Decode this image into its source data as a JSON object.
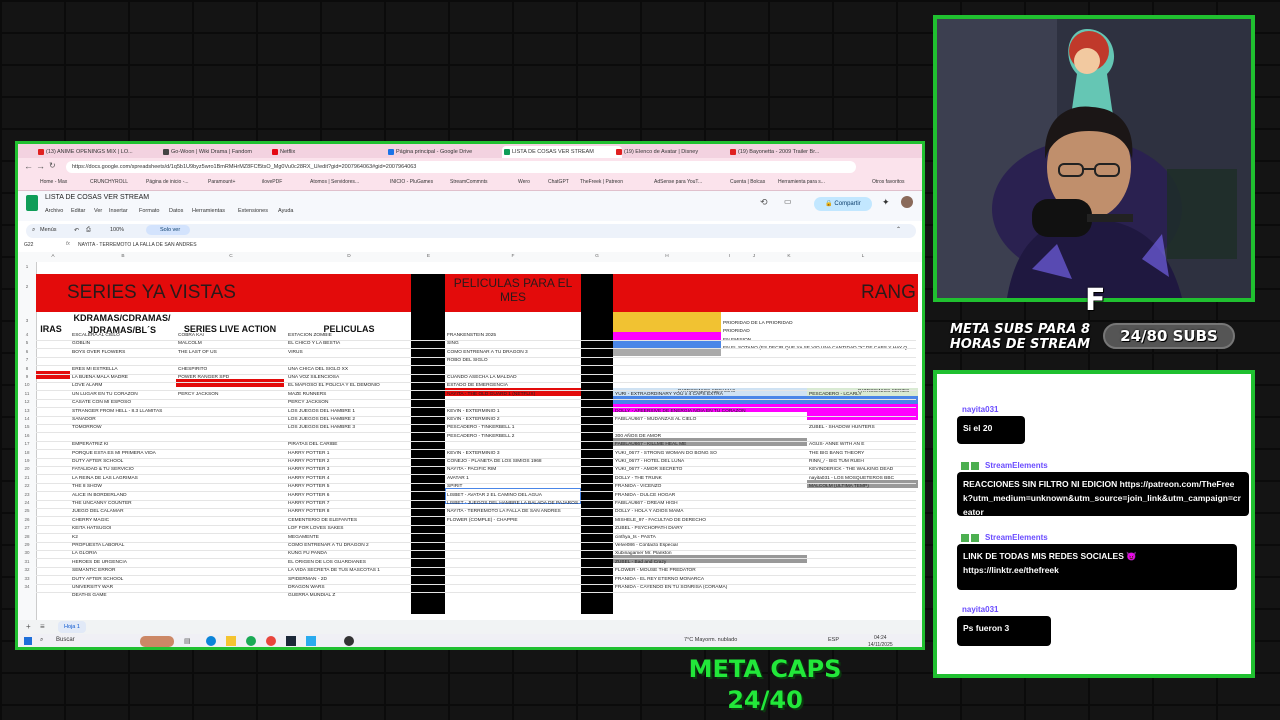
{
  "browser": {
    "tabs": [
      {
        "label": "(13) ANIME OPENINGS MIX | LO...",
        "color": "#e02020"
      },
      {
        "label": "Go-Woon | Wiki Drama | Fandom",
        "color": "#444"
      },
      {
        "label": "Netflix",
        "color": "#e50914"
      },
      {
        "label": "Página principal - Google Drive",
        "color": "#1a73e8"
      },
      {
        "label": "LISTA DE COSAS VER STREAM",
        "color": "#0f9d58"
      },
      {
        "label": "(19) Elenco de Avatar | Disney",
        "color": "#e02020"
      },
      {
        "label": "(19) Bayonetta - 2009 Trailer Br...",
        "color": "#e02020"
      }
    ],
    "url": "https://docs.google.com/spreadsheets/d/1q5b1U9byz5wro1BmRMHrMZ8FCf5tsO_Mg0Vu0c28RX_U/edit?gid=2007964063#gid=2007964063",
    "bookmarks": [
      "Home - Max",
      "CRUNCHYROLL",
      "Página de inicio -...",
      "Paramount+",
      "ilovePDF",
      "Atomos | Servidores...",
      "INICIO - PluGames",
      "StreamCommnts",
      "Wero",
      "ChatGPT",
      "TheFreek | Patreon",
      "AdSense para YouT...",
      "Cuenta | Bolcas",
      "Herramienta para s...",
      "Otros favoritos"
    ]
  },
  "sheet": {
    "title": "LISTA DE COSAS VER STREAM",
    "menus": [
      "Archivo",
      "Editar",
      "Ver",
      "Insertar",
      "Formato",
      "Datos",
      "Herramientas",
      "Extensiones",
      "Ayuda"
    ],
    "share_label": "Compartir",
    "toolbar_menu": "Menús",
    "zoom": "100%",
    "view_mode": "Solo ver",
    "cell_ref": "G22",
    "formula": "NAYITA - TERREMOTO LA FALLA DE SAN ANDRES",
    "columns": [
      "A",
      "B",
      "C",
      "D",
      "E",
      "F",
      "G",
      "H",
      "I",
      "J",
      "K",
      "L"
    ],
    "rows": [
      "1",
      "2",
      "3",
      "4",
      "5",
      "6",
      "7",
      "8",
      "9",
      "10",
      "11",
      "12",
      "13",
      "14",
      "15",
      "16",
      "17",
      "18",
      "19",
      "20",
      "21",
      "22",
      "23",
      "24",
      "25",
      "26",
      "27",
      "28",
      "29",
      "30",
      "31",
      "32",
      "33",
      "34"
    ],
    "series_title": "SERIES YA VISTAS",
    "peliculas_title": "PELICULAS PARA EL MES",
    "rango_title": "RANG",
    "col_partial": "IRAS",
    "col_kdramas": "KDRAMAS/CDRAMAS/ JDRAMAS/BL´S",
    "col_live": "SERIES LIVE ACTION",
    "col_peliculas": "PELICULAS",
    "kdramas": [
      "ESCALERA AL CIELO",
      "GOBLIN",
      "BOYS OVER FLOWERS",
      "",
      "ERES MI ESTRELLA",
      "LA BUENA MALA MADRE",
      "LOVE ALARM",
      "UN LUGAR EN TU CORAZON",
      "CASATE CON MI ESPOSO",
      "STRANGER FROM HELL - 8.3 LLAMITAS",
      "SANADOR",
      "TOMORROW",
      "",
      "EMPERATRIZ KI",
      "PORQUE ESTA ES MI PRIMERA VIDA",
      "DUTY AFTER SCHOOL",
      "FATALIDAD & TU SERVICIO",
      "LA REINA DE LAS LAGRIMAS",
      "THE 8 SHOW",
      "ALICE IN BORDERLAND",
      "THE UNCANNY COUNTER",
      "JUEGO DEL CALAMAR",
      "CHERRY MAGIC",
      "KEITA HATSUGOI",
      "K2",
      "PROPUESTA LABORAL",
      "LA GLORIA",
      "HEROES DE URGENCIA",
      "SEMANTIC ERROR",
      "DUTY AFTER SCHOOL",
      "UNIVERSITY WAR",
      "DEATHS GAME"
    ],
    "live_action": [
      "COBRA KAI",
      "MALCOLM",
      "THE LAST OF US",
      "",
      "CHESPIRITO",
      "POWER RANGER SPD",
      "",
      "PERCY JACKSON"
    ],
    "peliculas": [
      "ESTACION ZOMBIE",
      "EL CHICO Y LA BESTIA",
      "VIRUS",
      "",
      "UNA CHICA DEL SIGLO XX",
      "UNA VOZ SILENCIOSA",
      "EL MAFIOSO EL POLICIA Y EL DEMONIO",
      "MAZE RUNNERS",
      "PERCY JACKSON",
      "LOS JUEGOS DEL HAMBRE 1",
      "LOS JUEGOS DEL HAMBRE 2",
      "LOS JUEGOS DEL HAMBRE 3",
      "",
      "PIRATAS DEL CARIBE",
      "HARRY POTTER 1",
      "HARRY POTTER 2",
      "HARRY POTTER 3",
      "HARRY POTTER 4",
      "HARRY POTTER 5",
      "HARRY POTTER 6",
      "HARRY POTTER 7",
      "HARRY POTTER 8",
      "CEMENTERIO DE ELEFANTES",
      "LOF FOR LOVES SAKES",
      "MEGAMENTE",
      "COMO ENTRENAR A TU DRAGON 2",
      "KUNG FU PANDA",
      "EL ORIGEN DE LOS GUARDIANES",
      "LA VIDA SECRETA DE TUS MASCOTAS 1",
      "SPIDERMAN - 2D",
      "DRAGON WARS",
      "GUERRA MUNDIAL Z"
    ],
    "peliculas_mes": [
      "FRANKENSTEIN 2025",
      "SING",
      "COMO ENTRENAR A TU DRAGON 3",
      "ROBO DEL SIGLO",
      "",
      "CUANDO ASECHA LA MALDAD",
      "ESTADO DE EMERGENCIA",
      "NAYITA - THE OLD GUARD 1 (NETFLIX)",
      "",
      "KEVIN - EXTERMINIO 1",
      "KEVIN - EXTERMINIO 2",
      "PESCADERO - TINKERBELL 1",
      "PESCADERO - TINKERBELL 2",
      "",
      "KEVIN - EXTERMINIO 3",
      "CONEJO - PLANETA DE LOS SIMIOS 1968",
      "NAYITA - PACIFIC RIM",
      "AVATAR 1",
      "SPIRIT",
      "LISBET - AVATAR 2 EL CAMINO DEL AGUA",
      "LISBET - JUEGOS DEL HAMBRE LA BALADA DE PAJAROS",
      "NAYITA - TERREMOTO LA FALLA DE SAN ANDRES",
      "FLOWER (COMPLE) - CHAPPIE"
    ],
    "legend": [
      "PRIORIDAD DE LA PRIORIDAD",
      "PRIORIDAD",
      "EN EMISION",
      "EN EL SOTANO (ES DECIR QUE YA SE VIO UNA CANTIDAD \"X\" DE CAPS Y HAY Q"
    ],
    "patrocinios_kdramas_title": "PATROCINIOS KDRAMAS",
    "patrocinios_series_title": "PATROCINIOS SERIES",
    "patrocinios_kdramas": [
      "YURI - EXTRAORDINARY YOU x 4 CAPS EXTRA",
      "",
      "DOLLY - AFEERSIVE DE ENERGIA NOIA EN TU CORAZON",
      "FABILAU667 - MUDANZAS AL CIELO",
      "",
      "300 AÑOS DE AMOR",
      "FABILAU667 - KILLME HEAL ME",
      "YUKI_0677 - STRONG WOMAN DO BONG SO",
      "YUKI_0677 - HOTEL DEL LUNA",
      "YUKI_0677 - AMOR SECRETO",
      "DOLLY - THE TRUNK",
      "FRANIDA - VICENZO",
      "FRANIDA - DULCE HOGAR",
      "FABILAU667 - DREAM HIGH",
      "DOLLY - HOLA Y ADIOS MAMA",
      "MISHELE_97 - FACULTAD DE DERECHO",
      "ZUBEL - PSYCHOPATH DIARY",
      "cinthya_ts - PASTA",
      "Velve086 - Contacto Especial",
      "Xubinagamer Mr. Plankton",
      "ZUBEL - Bad and Crazy",
      "FLOWER - MOUSE THE PREDATOR",
      "FRANIDA - EL REY ETERNO MONARCA",
      "FRANIDA - CAYENDO EN TU SONRISA (CORAMA)"
    ],
    "patrocinios_series": [
      "PESCADERO - LCARLY",
      "",
      "",
      "",
      "ZUBEL - SHADOW HUNTERS",
      "",
      "AGUS- ANNE WITH AN E",
      "THE BIG BANG THEORY",
      "RINN_/ - BIG TUM RUEH",
      "KEVINDERICK - THE WALKING DEAD",
      "nayita031 - LOS MOSQUETEROS BBC",
      "MALCOLM (ULTIMA TEMP)"
    ],
    "sheet_tab": "Hoja 1"
  },
  "taskbar": {
    "search": "Buscar",
    "weather": "7°C  Mayorm. nublado",
    "lang": "ESP",
    "time": "04:24",
    "date": "14/11/2025"
  },
  "overlay": {
    "meta_subs_label": "META SUBS PARA 8 HORAS DE STREAM",
    "subs_count": "24/80 SUBS",
    "logo_letter": "F",
    "meta_caps_label": "META CAPS",
    "caps_count": "24/40"
  },
  "chat": {
    "messages": [
      {
        "user": "nayita031",
        "text": "Si el 20",
        "is_bot": false
      },
      {
        "user": "StreamElements",
        "text": "REACCIONES SIN FILTRO NI EDICION https://patreon.com/TheFreek?utm_medium=unknown&utm_source=join_link&utm_campaign=creator",
        "is_bot": true
      },
      {
        "user": "StreamElements",
        "text": "LINK DE TODAS MIS REDES SOCIALES 😈 https://linktr.ee/thefreek",
        "is_bot": true
      },
      {
        "user": "nayita031",
        "text": "Ps fueron 3",
        "is_bot": false
      }
    ]
  },
  "colors": {
    "frame_green": "#20c030",
    "sheet_red": "#e30b0b",
    "priority_yellow": "#f1c232",
    "priority_magenta": "#ff00ff",
    "priority_blue": "#4a86e8",
    "chat_user": "#6a4cff"
  }
}
